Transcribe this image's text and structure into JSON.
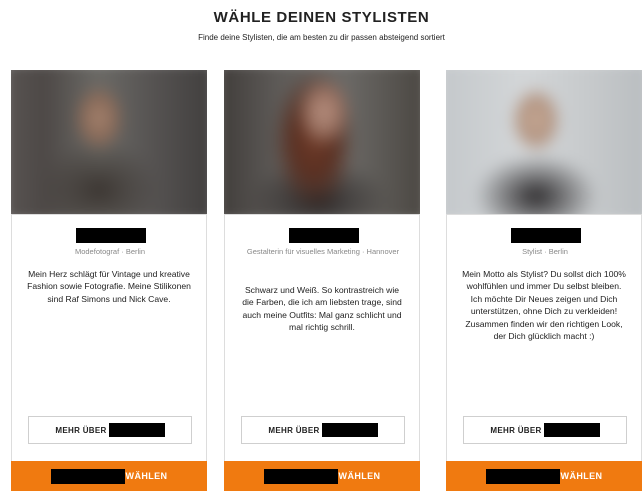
{
  "header": {
    "title": "WÄHLE DEINEN STYLISTEN",
    "subtitle": "Finde deine Stylisten, die am besten zu dir passen absteigend sortiert"
  },
  "cards": [
    {
      "role": "Modefotograf · Berlin",
      "bio": "Mein Herz schlägt für Vintage und kreative Fashion sowie Fotografie. Meine Stilikonen sind Raf Simons und Nick Cave.",
      "more_label": "MEHR ÜBER",
      "choose_label": "WÄHLEN"
    },
    {
      "role": "Gestalterin für visuelles Marketing · Hannover",
      "bio": "Schwarz und Weiß. So kontrastreich wie die Farben, die ich am liebsten trage, sind auch meine Outfits: Mal ganz schlicht und mal richtig schrill.",
      "more_label": "MEHR ÜBER",
      "choose_label": "WÄHLEN"
    },
    {
      "role": "Stylist · Berlin",
      "bio": "Mein Motto als Stylist? Du sollst dich 100% wohlfühlen und immer Du selbst bleiben. Ich möchte Dir Neues zeigen und Dich unterstützen, ohne Dich zu verkleiden! Zusammen finden wir den richtigen Look, der Dich glücklich macht :)",
      "more_label": "MEHR ÜBER",
      "choose_label": "WÄHLEN"
    }
  ],
  "colors": {
    "accent": "#f07a10",
    "redaction": "#000000"
  }
}
